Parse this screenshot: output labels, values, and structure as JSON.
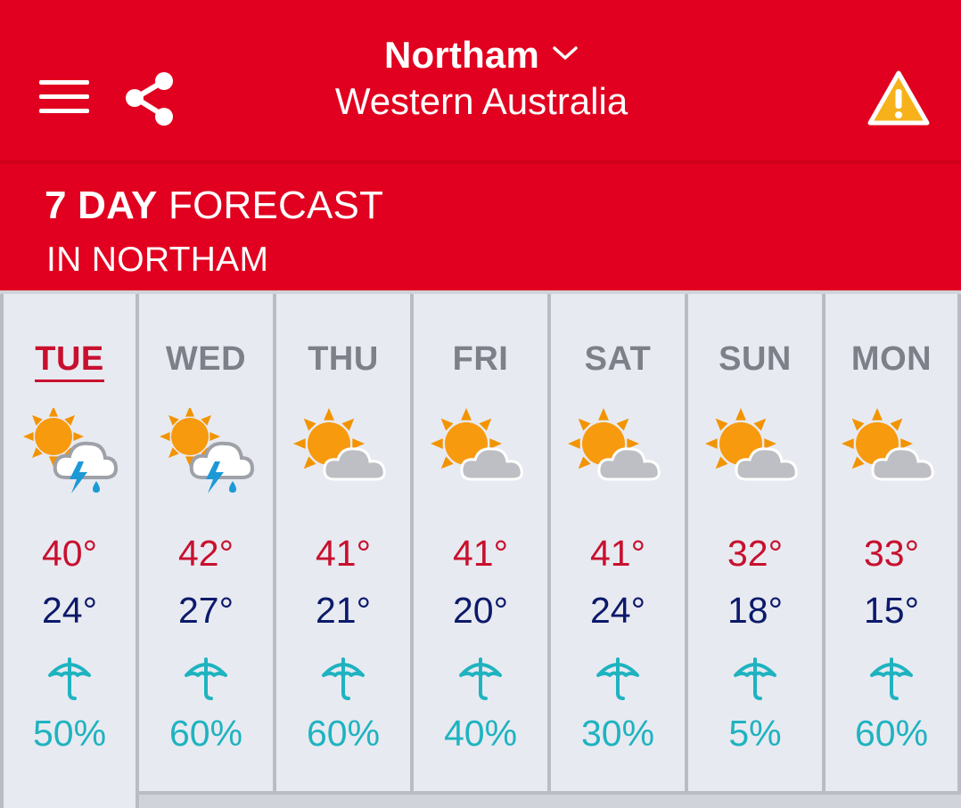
{
  "header": {
    "location_name": "Northam",
    "location_state": "Western Australia"
  },
  "icons": {
    "menu": "menu-icon",
    "share": "share-icon",
    "location_dropdown": "chevron-down-icon",
    "warning": "warning-icon",
    "rain_chance": "umbrella-icon"
  },
  "forecast": {
    "title_bold": "7 DAY",
    "title_rest": "FORECAST",
    "subtitle": "IN NORTHAM"
  },
  "days": [
    {
      "name": "TUE",
      "max": "40°",
      "min": "24°",
      "rain": "50%",
      "icon": "storm-icon",
      "selected": true
    },
    {
      "name": "WED",
      "max": "42°",
      "min": "27°",
      "rain": "60%",
      "icon": "storm-icon",
      "selected": false
    },
    {
      "name": "THU",
      "max": "41°",
      "min": "21°",
      "rain": "60%",
      "icon": "partly-cloudy-icon",
      "selected": false
    },
    {
      "name": "FRI",
      "max": "41°",
      "min": "20°",
      "rain": "40%",
      "icon": "partly-cloudy-icon",
      "selected": false
    },
    {
      "name": "SAT",
      "max": "41°",
      "min": "24°",
      "rain": "30%",
      "icon": "partly-cloudy-icon",
      "selected": false
    },
    {
      "name": "SUN",
      "max": "32°",
      "min": "18°",
      "rain": "5%",
      "icon": "partly-cloudy-icon",
      "selected": false
    },
    {
      "name": "MON",
      "max": "33°",
      "min": "15°",
      "rain": "60%",
      "icon": "partly-cloudy-icon",
      "selected": false
    }
  ],
  "colors": {
    "brand_red": "#e1001f",
    "max_temp": "#c8102e",
    "min_temp": "#0b1a6a",
    "rain": "#1fb3c0",
    "warning_yellow": "#f7b21b"
  }
}
